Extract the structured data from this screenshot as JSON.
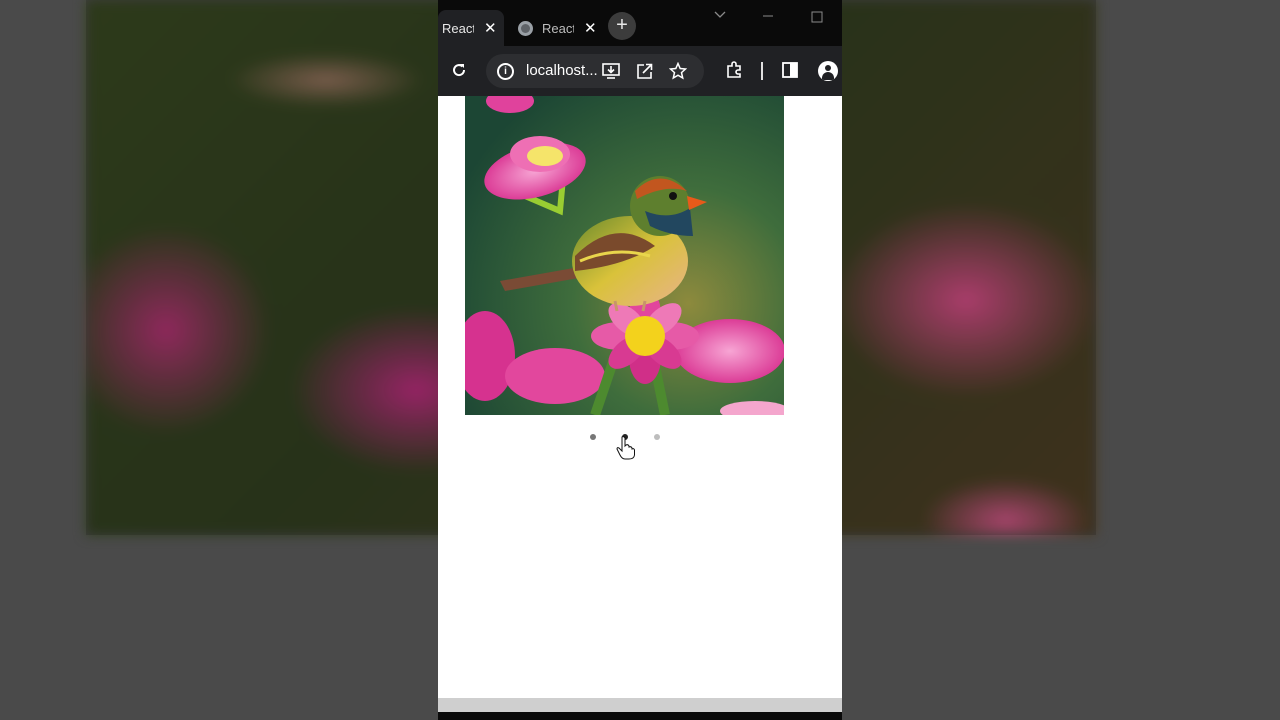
{
  "tabs": [
    {
      "title": "React",
      "close": "✕",
      "active": true
    },
    {
      "title": "React",
      "close": "✕",
      "active": false
    }
  ],
  "new_tab_label": "+",
  "address_bar": {
    "url": "localhost..."
  },
  "carousel": {
    "total_slides": 3,
    "active_index": 1,
    "image_alt": "bird on pink flower"
  },
  "colors": {
    "tabstrip": "#0a0a0a",
    "toolbar": "#202124",
    "omnibox": "#2d2e31",
    "page": "#ffffff"
  },
  "icons": [
    "reload-icon",
    "info-icon",
    "install-icon",
    "share-icon",
    "star-icon",
    "extensions-icon",
    "side-panel-icon",
    "profile-icon",
    "globe-icon",
    "close-icon",
    "plus-icon",
    "pointer-cursor-icon"
  ]
}
